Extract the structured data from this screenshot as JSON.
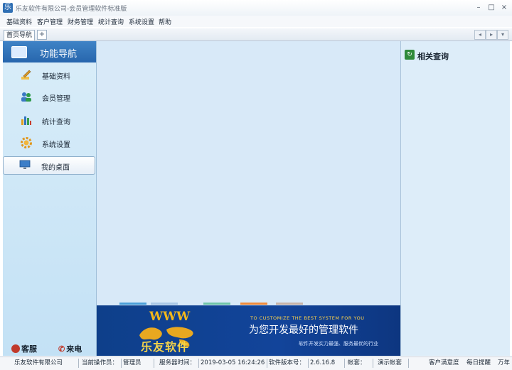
{
  "window": {
    "title": "乐友软件有限公司-会员管理软件标准版",
    "controls": {
      "minimize": "–",
      "maximize": "□",
      "close": "×"
    }
  },
  "menu": [
    {
      "label": "基础资料"
    },
    {
      "label": "客户管理"
    },
    {
      "label": "财务管理"
    },
    {
      "label": "统计查询"
    },
    {
      "label": "系统设置"
    },
    {
      "label": "帮助"
    }
  ],
  "tabs": [
    {
      "label": "首页导航"
    }
  ],
  "tab_add": "+",
  "sidebar": {
    "header": "功能导航",
    "items": [
      {
        "label": "基础资料",
        "icon": "pencil-icon"
      },
      {
        "label": "会员管理",
        "icon": "users-icon"
      },
      {
        "label": "统计查询",
        "icon": "bar-chart-icon"
      },
      {
        "label": "系统设置",
        "icon": "gear-icon"
      },
      {
        "label": "我的桌面",
        "icon": "monitor-icon",
        "selected": true
      }
    ],
    "footer": [
      {
        "label": "客服",
        "icon": "service-icon"
      },
      {
        "label": "来电",
        "icon": "phone-icon"
      }
    ]
  },
  "banner": {
    "www": "WWW",
    "brand": "乐友软件",
    "english": "TO CUSTOMIZE THE BEST SYSTEM FOR YOU",
    "slogan": "为您开发最好的管理软件",
    "subtitle": "软件开发实力最强、服务最优的行业"
  },
  "right_panel": {
    "title": "相关查询"
  },
  "status": [
    {
      "text": "乐友软件有限公司"
    },
    {
      "text": "当前操作员："
    },
    {
      "text": "管理员"
    },
    {
      "text": "服务器时间："
    },
    {
      "text": "2019-03-05 16:24:26"
    },
    {
      "text": "软件版本号："
    },
    {
      "text": "2.6.16.8"
    },
    {
      "text": "帐套："
    },
    {
      "text": "演示帐套"
    },
    {
      "text": "客户满意度"
    },
    {
      "text": "每日提醒"
    },
    {
      "text": "万年"
    }
  ],
  "colors": {
    "nav_header": "#2f74b8",
    "sidebar": "#cde6f7",
    "main": "#d8e9f8",
    "banner": "#12449a",
    "banner_accent": "#f4b81a"
  }
}
